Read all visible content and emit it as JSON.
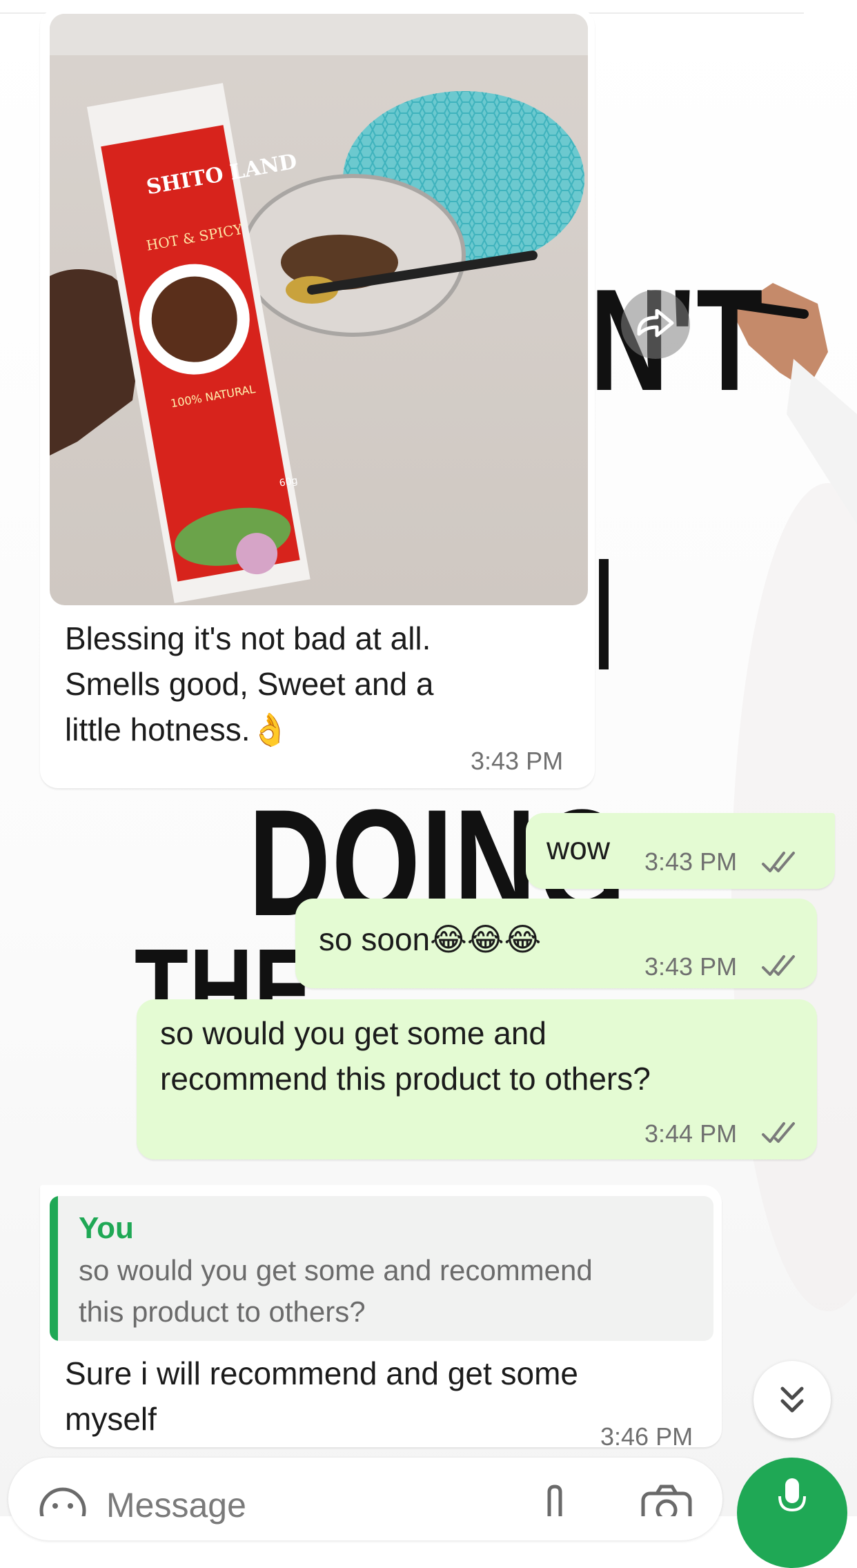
{
  "messages": [
    {
      "direction": "incoming",
      "attachment": "photo",
      "text": "Blessing it's not bad at all. Smells good, Sweet and a little hotness.👌",
      "lines": [
        "Blessing it's not bad at all.",
        "Smells good, Sweet and a",
        "little hotness.👌"
      ],
      "time": "3:43 PM"
    },
    {
      "direction": "outgoing",
      "text": "wow",
      "time": "3:43 PM",
      "status": "read"
    },
    {
      "direction": "outgoing",
      "text": "so soon😂😂😂",
      "time": "3:43 PM",
      "status": "read"
    },
    {
      "direction": "outgoing",
      "text": "so would you get some and recommend this product to others?",
      "lines": [
        "so would you get some and",
        "recommend this product to others?"
      ],
      "time": "3:44 PM",
      "status": "read"
    },
    {
      "direction": "incoming",
      "reply_to": {
        "author": "You",
        "lines": [
          "so would you get some and recommend",
          "this product to others?"
        ]
      },
      "text": "Sure i will recommend and get some myself",
      "lines": [
        "Sure i will recommend and get some",
        "myself"
      ],
      "time": "3:46 PM"
    }
  ],
  "photo": {
    "package_brand": "SHITO LAND",
    "package_variant": "HOT & SPICY",
    "package_badge": "100% NATURAL",
    "package_weight": "60g"
  },
  "wallpaper_text": {
    "fragment_1": "N'T",
    "fragment_2": "DOING",
    "fragment_3": "THE"
  },
  "composer": {
    "placeholder": "Message"
  },
  "icons": {
    "forward": "forward-icon",
    "scroll_down": "chevron-double-down-icon",
    "emoji": "emoji-icon",
    "attach": "paperclip-icon",
    "camera": "camera-icon",
    "mic": "mic-icon",
    "read_receipt": "double-check-icon"
  },
  "colors": {
    "outgoing_bubble": "#e4fbd3",
    "incoming_bubble": "#ffffff",
    "accent_green": "#1fa855",
    "timestamp": "#6f6f6f",
    "quote_background": "#f1f2f1"
  }
}
